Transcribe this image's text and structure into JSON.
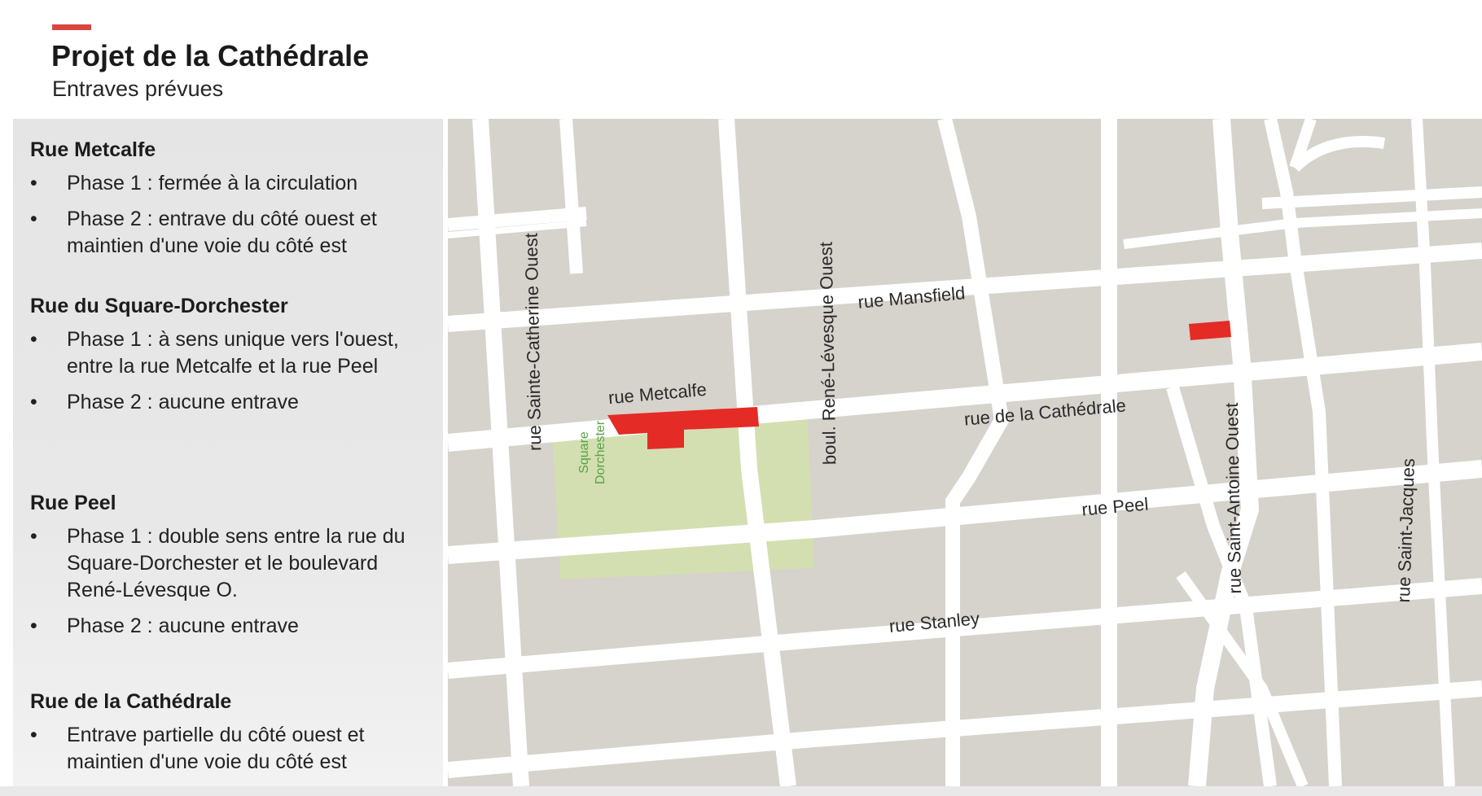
{
  "header": {
    "title": "Projet de la Cathédrale",
    "subtitle": "Entraves prévues",
    "accent_color": "#d9463e"
  },
  "sections": [
    {
      "heading": "Rue Metcalfe",
      "bullets": [
        "Phase 1 : fermée à la circulation",
        "Phase 2 : entrave du côté ouest et maintien d'une voie du côté est"
      ]
    },
    {
      "heading": "Rue du Square-Dorchester",
      "bullets": [
        "Phase 1 : à sens unique vers l'ouest, entre la rue Metcalfe et la rue Peel",
        "Phase 2 : aucune entrave"
      ]
    },
    {
      "heading": "Rue Peel",
      "bullets": [
        "Phase 1 : double sens entre la rue du Square-Dorchester et le boulevard René-Lévesque O.",
        "Phase 2 : aucune entrave"
      ]
    },
    {
      "heading": "Rue de la Cathédrale",
      "bullets": [
        "Entrave partielle du côté ouest et maintien d'une voie du côté est"
      ]
    }
  ],
  "bullet_glyph": "•",
  "map": {
    "street_labels": {
      "sainte_catherine": "rue Sainte-Catherine Ouest",
      "rene_levesque": "boul. René-Lévesque Ouest",
      "mansfield": "rue Mansfield",
      "metcalfe": "rue Metcalfe",
      "cathedrale": "rue de la Cathédrale",
      "peel": "rue Peel",
      "stanley": "rue Stanley",
      "saint_antoine": "rue Saint-Antoine Ouest",
      "saint_jacques": "rue Saint-Jacques"
    },
    "park_label_line1": "Square",
    "park_label_line2": "Dorchester",
    "colors": {
      "block": "#d6d2cc",
      "road": "#ffffff",
      "park": "#d3dfb0",
      "closure": "#e52b25"
    }
  }
}
